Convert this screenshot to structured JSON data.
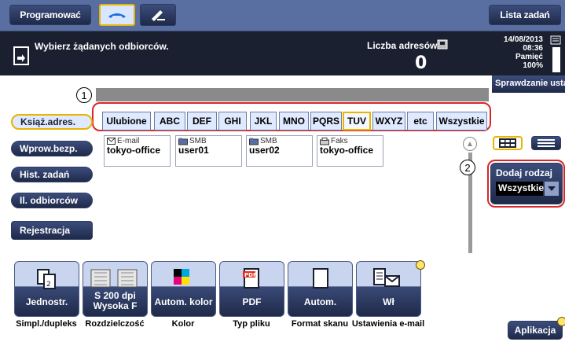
{
  "header": {
    "program_label": "Programować",
    "job_list_label": "Lista zadań"
  },
  "message": {
    "text": "Wybierz żądanych odbiorców.",
    "address_count_label": "Liczba adresów",
    "address_count_value": "0",
    "date": "14/08/2013",
    "time": "08:36",
    "memory_label": "Pamięć",
    "memory_value": "100%",
    "check_label": "Sprawdzanie usta"
  },
  "index_tabs": [
    "Ulubione",
    "ABC",
    "DEF",
    "GHI",
    "JKL",
    "MNO",
    "PQRS",
    "TUV",
    "WXYZ",
    "etc",
    "Wszystkie"
  ],
  "active_index_tab": "TUV",
  "left_nav": {
    "items": [
      "Książ.adres.",
      "Wprow.bezp.",
      "Hist. zadań",
      "Il. odbiorców"
    ],
    "active": "Książ.adres.",
    "register_label": "Rejestracja"
  },
  "addresses": [
    {
      "type": "E-mail",
      "type_icon": "envelope-icon",
      "name": "tokyo-office"
    },
    {
      "type": "SMB",
      "type_icon": "smb-folder-icon",
      "name": "user01"
    },
    {
      "type": "SMB",
      "type_icon": "smb-folder-icon",
      "name": "user02"
    },
    {
      "type": "Faks",
      "type_icon": "fax-icon",
      "name": "tokyo-office"
    }
  ],
  "filter": {
    "label": "Dodaj rodzaj",
    "selected": "Wszystkie"
  },
  "callouts": [
    "1",
    "2"
  ],
  "functions": [
    {
      "icon": "simplex-duplex-icon",
      "value": "Jednostr.",
      "caption": "Simpl./dupleks"
    },
    {
      "icon": "resolution-icon",
      "value": "S 200 dpi Wysoka F",
      "caption": "Rozdzielczość"
    },
    {
      "icon": "color-icon",
      "value": "Autom. kolor",
      "caption": "Kolor"
    },
    {
      "icon": "pdf-file-icon",
      "value": "PDF",
      "caption": "Typ pliku"
    },
    {
      "icon": "scan-format-icon",
      "value": "Autom.",
      "caption": "Format skanu"
    },
    {
      "icon": "email-settings-icon",
      "value": "Wł",
      "caption": "Ustawienia e-mail"
    }
  ],
  "app_label": "Aplikacja",
  "colors": {
    "accent": "#e8b400",
    "highlight_outline": "#d8262b",
    "header_bar": "#5a6fa1",
    "dark_band": "#1b2030"
  }
}
